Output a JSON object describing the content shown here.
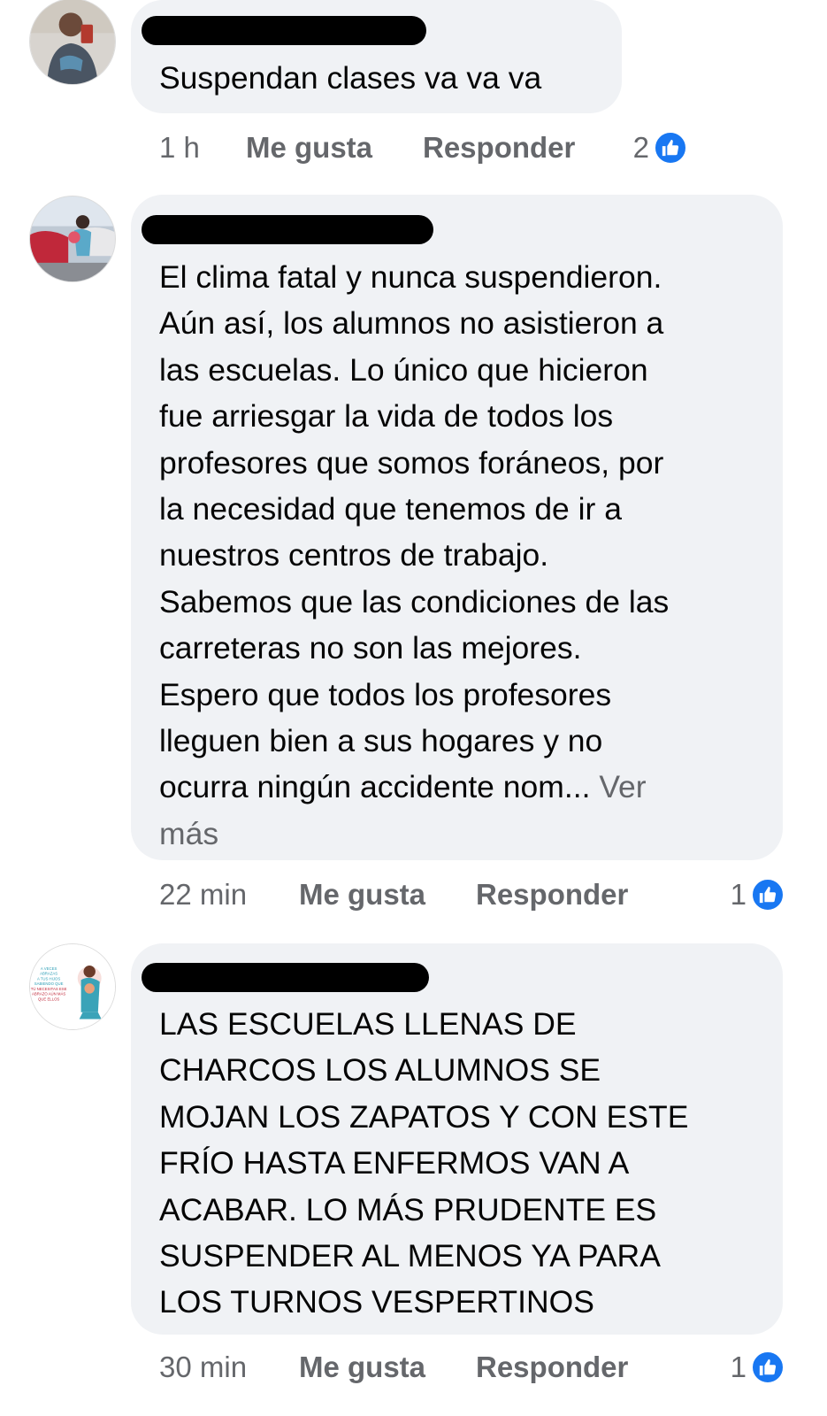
{
  "comments": [
    {
      "author_redacted": true,
      "lines": [
        "Suspendan clases va va va"
      ],
      "see_more": "",
      "time": "1 h",
      "like_label": "Me gusta",
      "reply_label": "Responder",
      "reaction_count": "2"
    },
    {
      "author_redacted": true,
      "lines": [
        "El clima fatal y nunca suspendieron.",
        "Aún así, los alumnos no asistieron a",
        "las escuelas. Lo único que hicieron",
        "fue arriesgar la vida de todos los",
        "profesores que somos foráneos, por",
        "la necesidad que tenemos de ir a",
        "nuestros centros de trabajo.",
        "Sabemos que las condiciones de las",
        "carreteras no son las mejores.",
        "Espero que todos los profesores",
        "lleguen bien a sus hogares y no",
        "ocurra ningún accidente nom..."
      ],
      "see_more": "Ver",
      "see_more_cont": "más",
      "time": "22 min",
      "like_label": "Me gusta",
      "reply_label": "Responder",
      "reaction_count": "1"
    },
    {
      "author_redacted": true,
      "avatar_text": [
        "A VECES",
        "ABRAZAS",
        "A TUS HIJOS",
        "SABIENDO QUE",
        "TÚ NECESITAS ESE",
        "ABRAZO AÚN MÁS",
        "QUE ELLOS"
      ],
      "lines": [
        "LAS ESCUELAS LLENAS DE",
        "CHARCOS LOS ALUMNOS SE",
        "MOJAN LOS ZAPATOS Y CON ESTE",
        "FRÍO HASTA ENFERMOS VAN A",
        "ACABAR. LO MÁS PRUDENTE ES",
        "SUSPENDER AL MENOS YA PARA",
        "LOS TURNOS VESPERTINOS"
      ],
      "see_more": "",
      "time": "30 min",
      "like_label": "Me gusta",
      "reply_label": "Responder",
      "reaction_count": "1"
    }
  ],
  "colors": {
    "bubble": "#f0f2f5",
    "meta_text": "#65676b",
    "like_blue": "#1877f2"
  }
}
